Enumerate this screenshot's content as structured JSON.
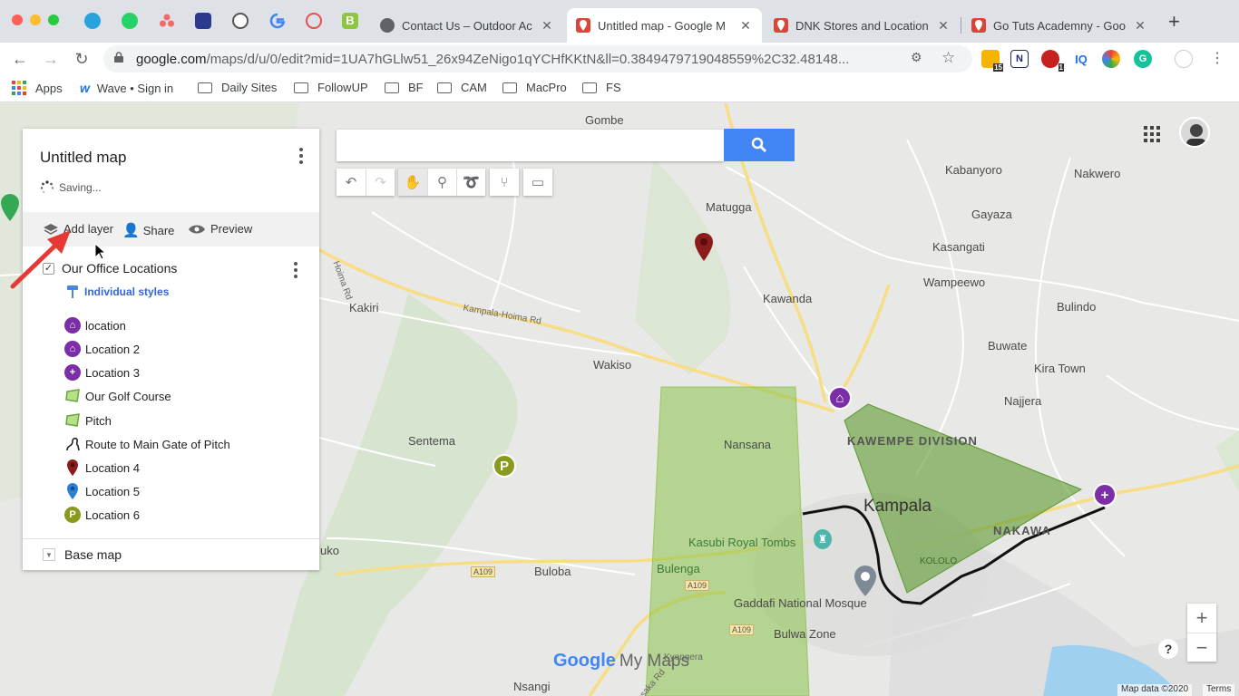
{
  "browser": {
    "pinned_tabs": [
      "telegram-icon",
      "whatsapp-icon",
      "asana-icon",
      "cloud-icon",
      "wordpress-icon",
      "google-icon",
      "airtable-icon",
      "b-icon"
    ],
    "tabs": [
      {
        "title": "Contact Us – Outdoor Ac",
        "favicon": "globe-icon"
      },
      {
        "title": "Untitled map - Google M",
        "favicon": "maps-pin-icon",
        "active": true
      },
      {
        "title": "DNK Stores and Location",
        "favicon": "maps-pin-icon"
      },
      {
        "title": "Go Tuts Academny - Goo",
        "favicon": "maps-pin-icon"
      }
    ],
    "url_host": "google.com",
    "url_path": "/maps/d/u/0/edit?mid=1UA7hGLlw51_26x94ZeNigo1qYCHfKKtN&ll=0.3849479719048559%2C32.48148...",
    "extension_badges": {
      "first": "15",
      "fourth": "1"
    },
    "ext_iq": "IQ",
    "bookmarks": [
      {
        "label": "Apps",
        "icon": "apps-grid-icon"
      },
      {
        "label": "Wave • Sign in",
        "icon": "wave-icon"
      },
      {
        "label": "Daily Sites",
        "icon": "folder-icon"
      },
      {
        "label": "FollowUP",
        "icon": "folder-icon"
      },
      {
        "label": "BF",
        "icon": "folder-icon"
      },
      {
        "label": "CAM",
        "icon": "folder-icon"
      },
      {
        "label": "MacPro",
        "icon": "folder-icon"
      },
      {
        "label": "FS",
        "icon": "folder-icon"
      }
    ]
  },
  "map_panel": {
    "title": "Untitled map",
    "status": "Saving...",
    "actions": {
      "add_layer": "Add layer",
      "share": "Share",
      "preview": "Preview"
    },
    "layer": {
      "name": "Our Office Locations",
      "checked": true,
      "style": "Individual styles",
      "items": [
        {
          "label": "location",
          "icon": "home-marker-icon",
          "color": "#7b2ea8"
        },
        {
          "label": "Location 2",
          "icon": "home-marker-icon",
          "color": "#7b2ea8"
        },
        {
          "label": "Location 3",
          "icon": "plus-marker-icon",
          "color": "#7b2ea8"
        },
        {
          "label": "Our Golf Course",
          "icon": "polygon-icon",
          "color": "#8bc34a"
        },
        {
          "label": "Pitch",
          "icon": "polygon-icon",
          "color": "#8bc34a"
        },
        {
          "label": "Route to Main Gate of Pitch",
          "icon": "route-icon",
          "color": "#222222"
        },
        {
          "label": "Location 4",
          "icon": "pin-icon",
          "color": "#8c1c1c"
        },
        {
          "label": "Location 5",
          "icon": "pin-icon",
          "color": "#2a7fd4"
        },
        {
          "label": "Location 6",
          "icon": "p-marker-icon",
          "color": "#8a9a1c"
        }
      ]
    },
    "base_map": "Base map"
  },
  "map": {
    "places": [
      "Gombe",
      "Kabanyoro",
      "Nakwero",
      "Matugga",
      "Gayaza",
      "Kasangati",
      "Wampeewo",
      "Kawanda",
      "Bulindo",
      "Kakiri",
      "Kampala-Hoima Rd",
      "Buwate",
      "Wakiso",
      "Kira Town",
      "Najjera",
      "Nansana",
      "KAWEMPE DIVISION",
      "Sentema",
      "Kampala",
      "NAKAWA",
      "Kasubi Royal Tombs",
      "Bulenga",
      "Buloba",
      "Gaddafi National Mosque",
      "Bulwa Zone",
      "Kyengera",
      "Nsangi",
      "Masaka Rd",
      "Hoima Rd",
      "A109",
      "uko",
      "KOLOLO"
    ],
    "footer_data": "Map data ©2020",
    "footer_terms": "Terms",
    "logo_google": "Google",
    "logo_mymaps": "My Maps",
    "colors": {
      "polygon_fill": "#8bc34a",
      "purple_marker": "#7b2ea8",
      "red_marker": "#8c1c1c",
      "p_marker": "#8a9a1c",
      "search_button": "#4285f4"
    }
  }
}
